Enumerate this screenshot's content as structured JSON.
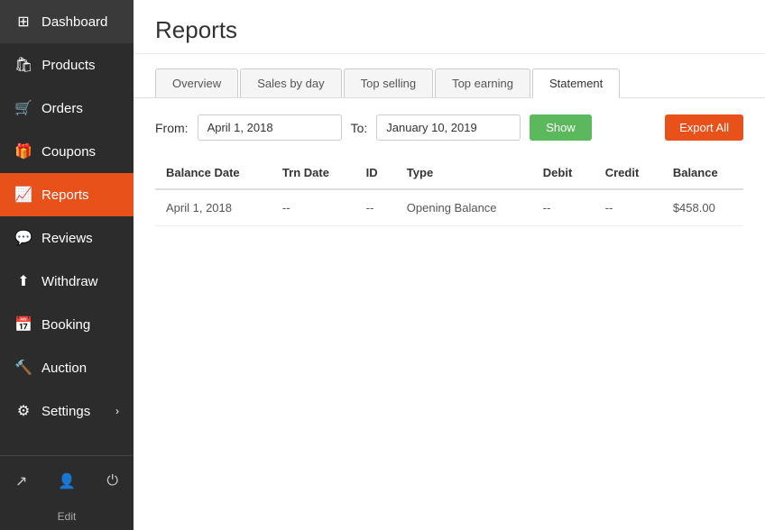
{
  "sidebar": {
    "items": [
      {
        "id": "dashboard",
        "label": "Dashboard",
        "icon": "⊞"
      },
      {
        "id": "products",
        "label": "Products",
        "icon": "🛍"
      },
      {
        "id": "orders",
        "label": "Orders",
        "icon": "🛒"
      },
      {
        "id": "coupons",
        "label": "Coupons",
        "icon": "🎁"
      },
      {
        "id": "reports",
        "label": "Reports",
        "icon": "📈",
        "active": true
      },
      {
        "id": "reviews",
        "label": "Reviews",
        "icon": "💬"
      },
      {
        "id": "withdraw",
        "label": "Withdraw",
        "icon": "⬆"
      },
      {
        "id": "booking",
        "label": "Booking",
        "icon": "📅"
      },
      {
        "id": "auction",
        "label": "Auction",
        "icon": "🔨"
      },
      {
        "id": "settings",
        "label": "Settings",
        "icon": "⚙",
        "has_arrow": true
      }
    ],
    "bottom": {
      "edit_label": "Edit"
    }
  },
  "page": {
    "title": "Reports",
    "breadcrumb": "Reports"
  },
  "tabs": [
    {
      "id": "overview",
      "label": "Overview"
    },
    {
      "id": "sales-by-day",
      "label": "Sales by day"
    },
    {
      "id": "top-selling",
      "label": "Top selling"
    },
    {
      "id": "top-earning",
      "label": "Top earning"
    },
    {
      "id": "statement",
      "label": "Statement",
      "active": true
    }
  ],
  "filters": {
    "from_label": "From:",
    "from_value": "April 1, 2018",
    "to_label": "To:",
    "to_value": "January 10, 2019",
    "show_label": "Show",
    "export_label": "Export All"
  },
  "table": {
    "columns": [
      {
        "id": "balance-date",
        "label": "Balance Date"
      },
      {
        "id": "trn-date",
        "label": "Trn Date"
      },
      {
        "id": "id",
        "label": "ID"
      },
      {
        "id": "type",
        "label": "Type"
      },
      {
        "id": "debit",
        "label": "Debit"
      },
      {
        "id": "credit",
        "label": "Credit"
      },
      {
        "id": "balance",
        "label": "Balance"
      }
    ],
    "rows": [
      {
        "balance_date": "April 1, 2018",
        "trn_date": "--",
        "id": "--",
        "type": "Opening Balance",
        "debit": "--",
        "credit": "--",
        "balance": "$458.00"
      }
    ]
  }
}
